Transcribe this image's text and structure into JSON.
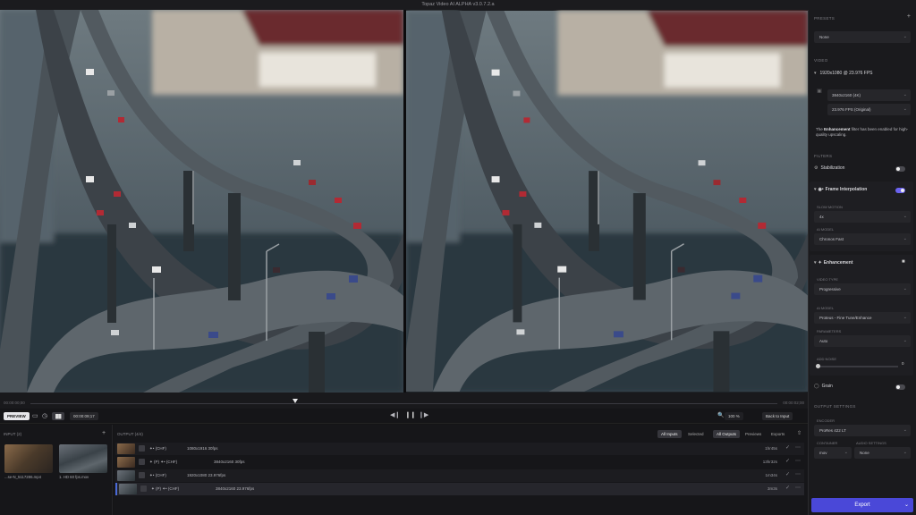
{
  "window": {
    "title": "Topaz Video AI ALPHA  v3.0.7.2.a"
  },
  "timeline": {
    "time_left": "00:00:00;00",
    "time_right": "00:00:02;00"
  },
  "controls": {
    "preview_label": "PREVIEW",
    "timecode": "00:00:09;17",
    "zoom": "100 %",
    "back_to_input": "Back to Input"
  },
  "input": {
    "header": "INPUT (2)",
    "items": [
      {
        "name": "...se-N_5117286.mp4"
      },
      {
        "name": "1. HD 60 fps.mov"
      }
    ]
  },
  "output": {
    "header": "OUTPUT (4/4)",
    "filters": [
      "All Inputs",
      "Selected",
      "All Outputs",
      "Previews",
      "Exports"
    ],
    "rows": [
      {
        "tags": "✦• (CHF)",
        "spec": "1080x1916  30fps",
        "time": "1hr45s"
      },
      {
        "tags": "✦ (P)  ✦• (CHF)",
        "spec": "3840x2160  30fps",
        "time": "13hr32s"
      },
      {
        "tags": "✦• (CHF)",
        "spec": "1920x1080  23.976fps",
        "time": "1m34s"
      },
      {
        "tags": "✦ (P)  ✦• (CHF)",
        "spec": "3840x2160  23.976fps",
        "time": "3m3s"
      }
    ]
  },
  "sidebar": {
    "presets_label": "PRESETS",
    "preset_value": "None",
    "video_label": "VIDEO",
    "video_summary": "1920x1080 @ 23.976 FPS",
    "resolution": "3840x2160 (4K)",
    "fps": "23.976 FPS (Original)",
    "note_bold": "Enhancement",
    "note_pre": "The ",
    "note_post": " filter has been enabled for high-quality upscaling.",
    "filters_label": "FILTERS",
    "stabilization": "Stabilization",
    "frame_interp": "Frame Interpolation",
    "slow_motion_label": "SLOW MOTION",
    "slow_motion_value": "4x",
    "fi_model_label": "AI MODEL",
    "fi_model_value": "Chronos Fast",
    "enhancement": "Enhancement",
    "video_type_label": "VIDEO TYPE",
    "video_type_value": "Progressive",
    "enh_model_label": "AI MODEL",
    "enh_model_value": "Proteus - Fine Tune/Enhance",
    "parameters_label": "PARAMETERS",
    "parameters_value": "Auto",
    "add_noise_label": "ADD NOISE",
    "add_noise_value": "0",
    "grain": "Grain",
    "output_settings_label": "OUTPUT SETTINGS",
    "encoder_label": "ENCODER",
    "encoder_value": "ProRes 422 LT",
    "container_label": "CONTAINER",
    "container_value": "mov",
    "audio_label": "AUDIO SETTINGS",
    "audio_value": "None",
    "export_label": "Export"
  },
  "colors": {
    "accent": "#4a48d8",
    "toggle_on": "#6b63f0"
  }
}
